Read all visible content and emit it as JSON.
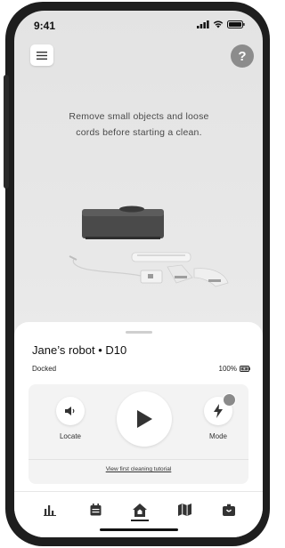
{
  "status_bar": {
    "time": "9:41"
  },
  "header": {
    "menu_icon": "hamburger-menu-icon",
    "help_label": "?"
  },
  "instruction": {
    "line1": "Remove small objects and loose",
    "line2": "cords before starting a clean."
  },
  "robot": {
    "name": "Jane’s robot • D10",
    "status": "Docked",
    "battery": "100%"
  },
  "controls": {
    "locate_label": "Locate",
    "mode_label": "Mode",
    "tutorial_link": "View first cleaning tutorial"
  },
  "tabs": [
    {
      "icon": "bar-chart-icon",
      "active": false
    },
    {
      "icon": "calendar-icon",
      "active": false
    },
    {
      "icon": "home-icon",
      "active": true
    },
    {
      "icon": "map-icon",
      "active": false
    },
    {
      "icon": "account-icon",
      "active": false
    }
  ],
  "colors": {
    "background": "#e6e6e6",
    "sheet": "#ffffff",
    "card": "#f3f3f3",
    "help_button": "#8c8c8c",
    "text": "#111111"
  }
}
